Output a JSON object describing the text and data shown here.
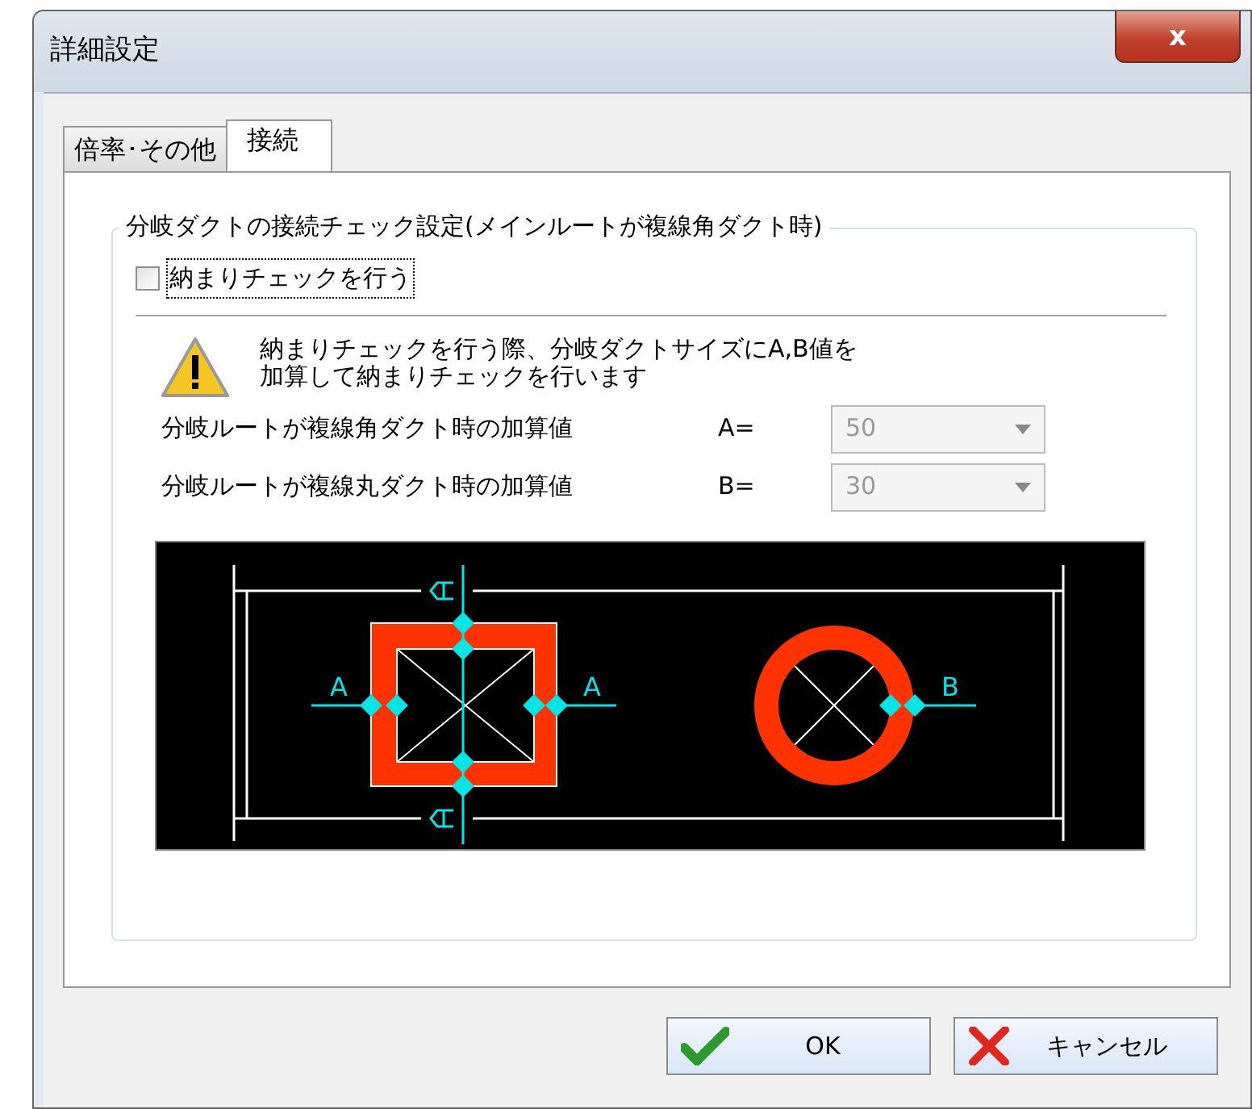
{
  "window": {
    "title": "詳細設定",
    "close": "x"
  },
  "tabs": [
    {
      "label": "倍率･その他",
      "selected": false
    },
    {
      "label": "接続",
      "selected": true
    }
  ],
  "group": {
    "title": "分岐ダクトの接続チェック設定(メインルートが複線角ダクト時)",
    "checkbox": {
      "label": "納まりチェックを行う",
      "checked": false
    },
    "warning": {
      "lines": [
        "納まりチェックを行う際、分岐ダクトサイズにA,B値を",
        "加算して納まりチェックを行います"
      ]
    },
    "fields": [
      {
        "label": "分岐ルートが複線角ダクト時の加算値",
        "key": "A=",
        "value": "50",
        "disabled": true
      },
      {
        "label": "分岐ルートが複線丸ダクト時の加算値",
        "key": "B=",
        "value": "30",
        "disabled": true
      }
    ],
    "diagram": {
      "labels": [
        "A",
        "A",
        "B"
      ]
    }
  },
  "buttons": [
    {
      "kind": "ok",
      "label": "OK"
    },
    {
      "kind": "cancel",
      "label": "キャンセル"
    }
  ]
}
